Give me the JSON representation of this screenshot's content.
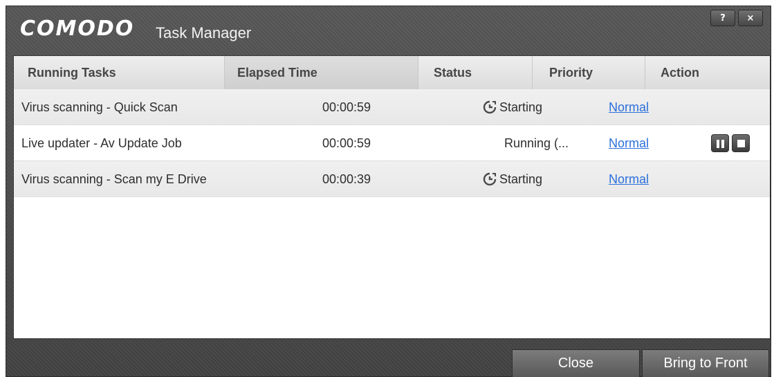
{
  "window": {
    "brand": "COMODO",
    "title": "Task Manager",
    "help_label": "?",
    "close_label": "×"
  },
  "table": {
    "columns": [
      "Running Tasks",
      "Elapsed Time",
      "Status",
      "Priority",
      "Action"
    ],
    "rows": [
      {
        "task": "Virus scanning - Quick Scan",
        "elapsed": "00:00:59",
        "status": "Starting",
        "status_icon": "clock-icon",
        "priority": "Normal",
        "actions": []
      },
      {
        "task": "Live updater - Av Update Job",
        "elapsed": "00:00:59",
        "status": "Running (...",
        "status_icon": "",
        "priority": "Normal",
        "actions": [
          "pause-icon",
          "stop-icon"
        ]
      },
      {
        "task": "Virus scanning - Scan my E Drive",
        "elapsed": "00:00:39",
        "status": "Starting",
        "status_icon": "clock-icon",
        "priority": "Normal",
        "actions": []
      }
    ]
  },
  "footer": {
    "close_label": "Close",
    "bring_to_front_label": "Bring to Front"
  },
  "colors": {
    "chrome": "#4b4b4b",
    "link": "#2a6fdb",
    "header": "#e4e4e4"
  }
}
